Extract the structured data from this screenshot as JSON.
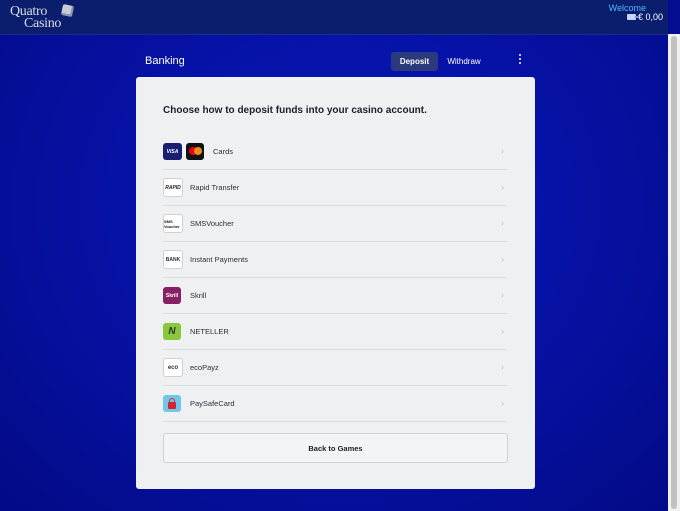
{
  "header": {
    "logo_line1": "Quatro",
    "logo_line2": "Casino",
    "welcome": "Welcome",
    "balance": "€ 0,00"
  },
  "banking": {
    "title": "Banking",
    "tab_deposit": "Deposit",
    "tab_withdraw": "Withdraw"
  },
  "panel": {
    "heading": "Choose how to deposit funds into your casino account.",
    "methods": [
      {
        "label": "Cards",
        "icon": "visa-mastercard-icon"
      },
      {
        "label": "Rapid Transfer",
        "icon": "rapid-transfer-icon"
      },
      {
        "label": "SMSVoucher",
        "icon": "smsvoucher-icon"
      },
      {
        "label": "Instant Payments",
        "icon": "instant-payments-icon"
      },
      {
        "label": "Skrill",
        "icon": "skrill-icon"
      },
      {
        "label": "NETELLER",
        "icon": "neteller-icon"
      },
      {
        "label": "ecoPayz",
        "icon": "ecopayz-icon"
      },
      {
        "label": "PaySafeCard",
        "icon": "paysafecard-icon"
      }
    ],
    "logo_text": {
      "visa": "VISA",
      "rapid": "RAPID",
      "sms": "SMS Voucher",
      "instant": "BANK",
      "skrill": "Skrill",
      "neteller": "N",
      "eco": "eco"
    },
    "back_label": "Back to Games"
  },
  "colors": {
    "accent": "#4cb6ff",
    "background": "#0612a6",
    "topbar": "#0b1e6e",
    "tab_active": "#2b3a7c"
  }
}
